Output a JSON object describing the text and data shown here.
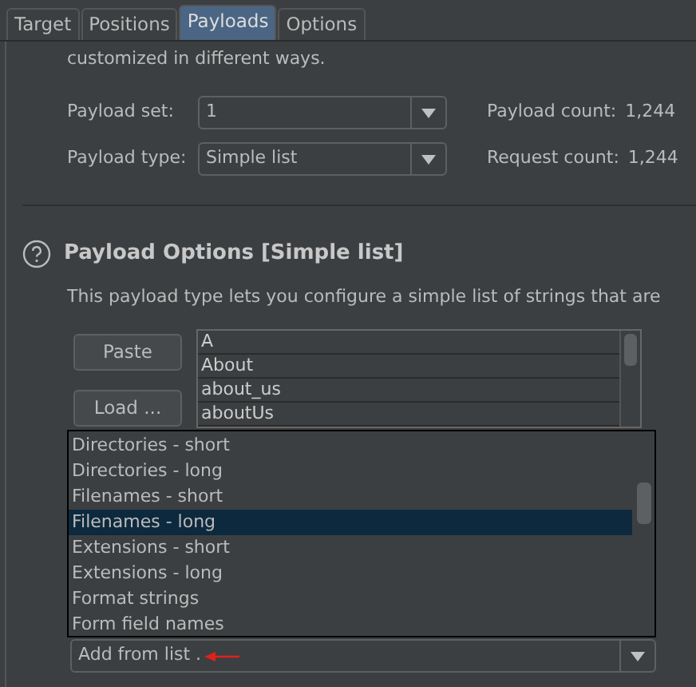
{
  "tabs": [
    {
      "label": "Target",
      "selected": false
    },
    {
      "label": "Positions",
      "selected": false
    },
    {
      "label": "Payloads",
      "selected": true
    },
    {
      "label": "Options",
      "selected": false
    }
  ],
  "intro_text": "customized in different ways.",
  "payload_set": {
    "label": "Payload set:",
    "value": "1"
  },
  "payload_type": {
    "label": "Payload type:",
    "value": "Simple list"
  },
  "payload_count": {
    "label": "Payload count:",
    "value": "1,244"
  },
  "request_count": {
    "label": "Request count:",
    "value": "1,244"
  },
  "section": {
    "title": "Payload Options [Simple list]",
    "description": "This payload type lets you configure a simple list of strings that are"
  },
  "buttons": [
    "Paste",
    "Load ..."
  ],
  "list_items": [
    "A",
    "About",
    "about_us",
    "aboutUs"
  ],
  "dropdown_menu": {
    "items": [
      {
        "label": "Directories - short",
        "selected": false
      },
      {
        "label": "Directories - long",
        "selected": false
      },
      {
        "label": "Filenames - short",
        "selected": false
      },
      {
        "label": "Filenames - long",
        "selected": true
      },
      {
        "label": "Extensions - short",
        "selected": false
      },
      {
        "label": "Extensions - long",
        "selected": false
      },
      {
        "label": "Format strings",
        "selected": false
      },
      {
        "label": "Form field names",
        "selected": false
      }
    ]
  },
  "add_from_list": {
    "value": "Add from list ."
  }
}
